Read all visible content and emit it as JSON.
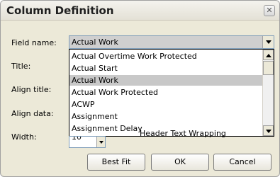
{
  "window": {
    "title": "Column Definition",
    "close_icon": "close-icon"
  },
  "labels": {
    "field_name": "Field name:",
    "title": "Title:",
    "align_title": "Align title:",
    "align_data": "Align data:",
    "width": "Width:"
  },
  "field_combo": {
    "value": "Actual Work"
  },
  "dropdown": {
    "items": [
      "Actual Overtime Work Protected",
      "Actual Start",
      "Actual Work",
      "Actual Work Protected",
      "ACWP",
      "Assignment",
      "Assignment Delay"
    ],
    "selected": "Actual Work"
  },
  "width_spin": {
    "value": "10"
  },
  "header_wrap": {
    "label": "Header Text Wrapping"
  },
  "buttons": {
    "best_fit": "Best Fit",
    "ok": "OK",
    "cancel": "Cancel"
  }
}
